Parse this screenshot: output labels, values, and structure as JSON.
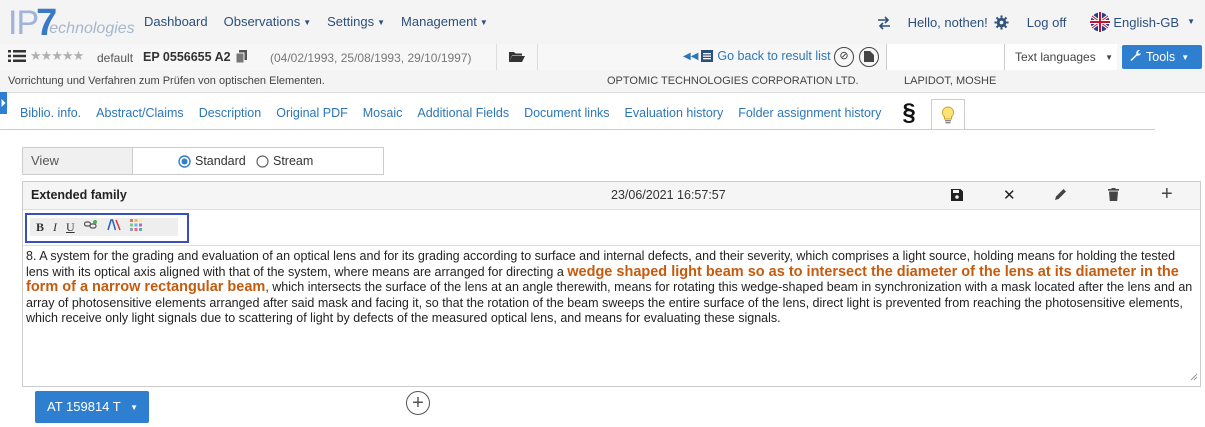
{
  "nav": {
    "logo_ip": "IP",
    "logo_seven": "7",
    "logo_tech": "echnologies",
    "menu": [
      {
        "label": "Dashboard",
        "dropdown": false
      },
      {
        "label": "Observations",
        "dropdown": true
      },
      {
        "label": "Settings",
        "dropdown": true
      },
      {
        "label": "Management",
        "dropdown": true
      }
    ],
    "greeting": "Hello, nothen!",
    "logoff": "Log off",
    "language": "English-GB"
  },
  "record": {
    "classification": "default",
    "patent_number": "EP 0556655 A2",
    "dates": "(04/02/1993, 25/08/1993, 29/10/1997)",
    "back_label": "Go back to result list",
    "text_languages": "Text languages",
    "tools": "Tools"
  },
  "info": {
    "title": "Vorrichtung und Verfahren zum Prüfen von optischen Elementen.",
    "applicant": "OPTOMIC TECHNOLOGIES CORPORATION LTD.",
    "inventor": "LAPIDOT, MOSHE"
  },
  "tabs": [
    "Biblio. info.",
    "Abstract/Claims",
    "Description",
    "Original PDF",
    "Mosaic",
    "Additional Fields",
    "Document links",
    "Evaluation history",
    "Folder assignment history"
  ],
  "view": {
    "label": "View",
    "options": [
      "Standard",
      "Stream"
    ],
    "selected": "Standard"
  },
  "card": {
    "title": "Extended family",
    "timestamp": "23/06/2021 16:57:57",
    "toolbar": {
      "bold": "B",
      "italic": "I",
      "underline": "U"
    },
    "text_before": "8. A system for the grading and evaluation of an optical lens and for its grading according to surface and internal defects, and their severity, which comprises a light source, holding means for holding the tested lens with its optical axis aligned with that of the system, where means are arranged for directing a ",
    "text_highlight": "wedge shaped light beam so as to intersect the diameter of the lens at its diameter in the form of a narrow rectangular beam",
    "text_after": ", which intersects the surface of the lens at an angle therewith, means for rotating this wedge-shaped beam in synchronization with a mask located after the lens and an array of photosensitive elements arranged after said mask and facing it, so that the rotation of the beam sweeps the entire surface of the lens, direct light is prevented from reaching the photosensitive elements, which receive only light signals due to scattering of light by defects of the measured optical lens, and means for evaluating these signals.",
    "highlight_color": "#c65a0d"
  },
  "footer": {
    "family_button": "AT 159814 T"
  },
  "colors": {
    "accent": "#2e7fd0",
    "link": "#2c76b8",
    "toolbar_border": "#3a4ec4"
  }
}
